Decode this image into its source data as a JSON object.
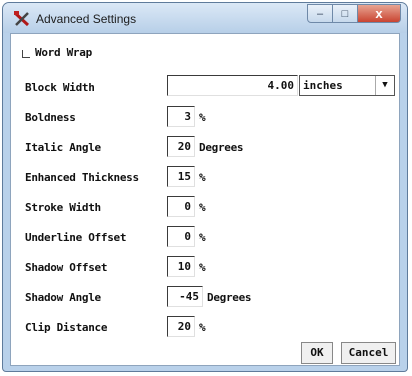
{
  "window": {
    "title": "Advanced Settings"
  },
  "title_buttons": {
    "minimize": "–",
    "maximize": "□",
    "close": "x"
  },
  "word_wrap": {
    "label": "Word Wrap"
  },
  "block_width": {
    "label": "Block Width",
    "value": "4.00",
    "unit_selected": "inches"
  },
  "rows": [
    {
      "label": "Boldness",
      "value": "3",
      "unit": "%"
    },
    {
      "label": "Italic Angle",
      "value": "20",
      "unit": "Degrees"
    },
    {
      "label": "Enhanced Thickness",
      "value": "15",
      "unit": "%"
    },
    {
      "label": "Stroke Width",
      "value": "0",
      "unit": "%"
    },
    {
      "label": "Underline Offset",
      "value": "0",
      "unit": "%"
    },
    {
      "label": "Shadow Offset",
      "value": "10",
      "unit": "%"
    },
    {
      "label": "Shadow Angle",
      "value": "-45",
      "unit": "Degrees"
    },
    {
      "label": "Clip Distance",
      "value": "20",
      "unit": "%"
    }
  ],
  "buttons": {
    "ok": "OK",
    "cancel": "Cancel"
  },
  "colors": {
    "title_bar": "#b9d1ea",
    "close": "#c94431",
    "client_bg": "#ffffff"
  },
  "icons": {
    "app": "tools-x-icon",
    "dropdown": "chevron-down-icon"
  }
}
